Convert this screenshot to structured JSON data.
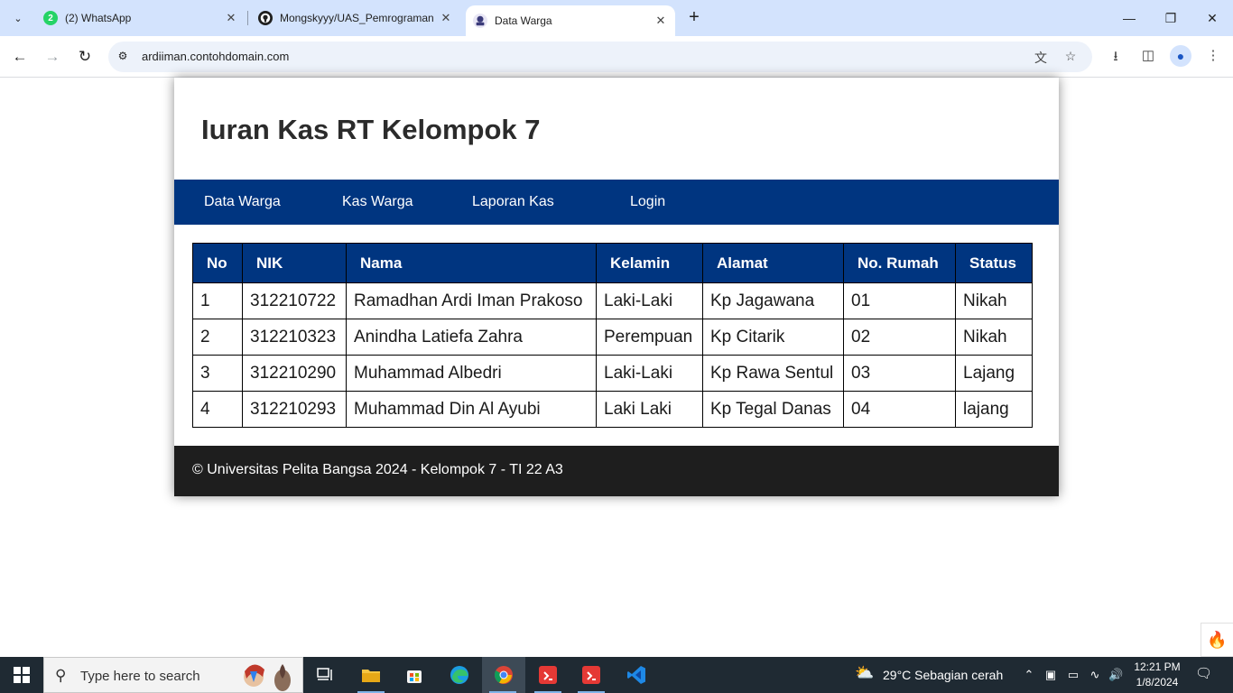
{
  "browser": {
    "tabs": [
      {
        "title": "(2) WhatsApp",
        "favicon": "whatsapp-icon",
        "badge": "2"
      },
      {
        "title": "Mongskyyy/UAS_Pemrograman",
        "favicon": "github-icon"
      },
      {
        "title": "Data Warga",
        "favicon": "site-icon",
        "active": true
      }
    ],
    "url": "ardiiman.contohdomain.com"
  },
  "page": {
    "title": "Iuran Kas RT Kelompok 7",
    "nav": [
      "Data Warga",
      "Kas Warga",
      "Laporan Kas",
      "Login"
    ],
    "table": {
      "headers": [
        "No",
        "NIK",
        "Nama",
        "Kelamin",
        "Alamat",
        "No. Rumah",
        "Status"
      ],
      "rows": [
        [
          "1",
          "312210722",
          "Ramadhan Ardi Iman Prakoso",
          "Laki-Laki",
          "Kp Jagawana",
          "01",
          "Nikah"
        ],
        [
          "2",
          "312210323",
          "Anindha Latiefa Zahra",
          "Perempuan",
          "Kp Citarik",
          "02",
          "Nikah"
        ],
        [
          "3",
          "312210290",
          "Muhammad Albedri",
          "Laki-Laki",
          "Kp Rawa Sentul",
          "03",
          "Lajang"
        ],
        [
          "4",
          "312210293",
          "Muhammad Din Al Ayubi",
          "Laki Laki",
          "Kp Tegal Danas",
          "04",
          "lajang"
        ]
      ]
    },
    "footer": "© Universitas Pelita Bangsa 2024 - Kelompok 7 - TI 22 A3"
  },
  "taskbar": {
    "search_placeholder": "Type here to search",
    "weather": "29°C  Sebagian cerah",
    "time": "12:21 PM",
    "date": "1/8/2024"
  },
  "colors": {
    "nav_blue": "#003580",
    "footer_dark": "#1e1e1e",
    "tabbar": "#d3e3fd"
  }
}
